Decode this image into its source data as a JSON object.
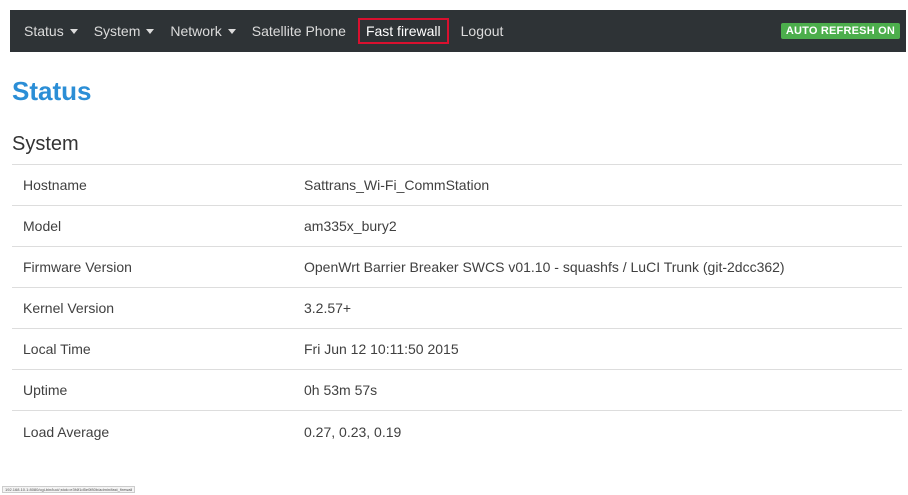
{
  "navbar": {
    "items": [
      {
        "label": "Status",
        "dropdown": true
      },
      {
        "label": "System",
        "dropdown": true
      },
      {
        "label": "Network",
        "dropdown": true
      },
      {
        "label": "Satellite Phone",
        "dropdown": false
      },
      {
        "label": "Fast firewall",
        "dropdown": false,
        "highlighted": true
      },
      {
        "label": "Logout",
        "dropdown": false
      }
    ],
    "auto_refresh": "AUTO REFRESH ON"
  },
  "page": {
    "title": "Status",
    "section": "System"
  },
  "system_info": [
    {
      "label": "Hostname",
      "value": "Sattrans_Wi-Fi_CommStation"
    },
    {
      "label": "Model",
      "value": "am335x_bury2"
    },
    {
      "label": "Firmware Version",
      "value": "OpenWrt Barrier Breaker SWCS v01.10 - squashfs / LuCI Trunk (git-2dcc362)"
    },
    {
      "label": "Kernel Version",
      "value": "3.2.57+"
    },
    {
      "label": "Local Time",
      "value": "Fri Jun 12 10:11:50 2015"
    },
    {
      "label": "Uptime",
      "value": "0h 53m 57s"
    },
    {
      "label": "Load Average",
      "value": "0.27, 0.23, 0.19"
    }
  ],
  "statusbar": {
    "url": "192.168.10.1:8080/cgi-bin/luci/;stok=e3f4f1d5e0f80b/admin/fast_firewall"
  },
  "colors": {
    "navbar_bg": "#2e3336",
    "title_blue": "#2b8ed6",
    "highlight_border": "#d9102f",
    "badge_green": "#4cae4c"
  }
}
